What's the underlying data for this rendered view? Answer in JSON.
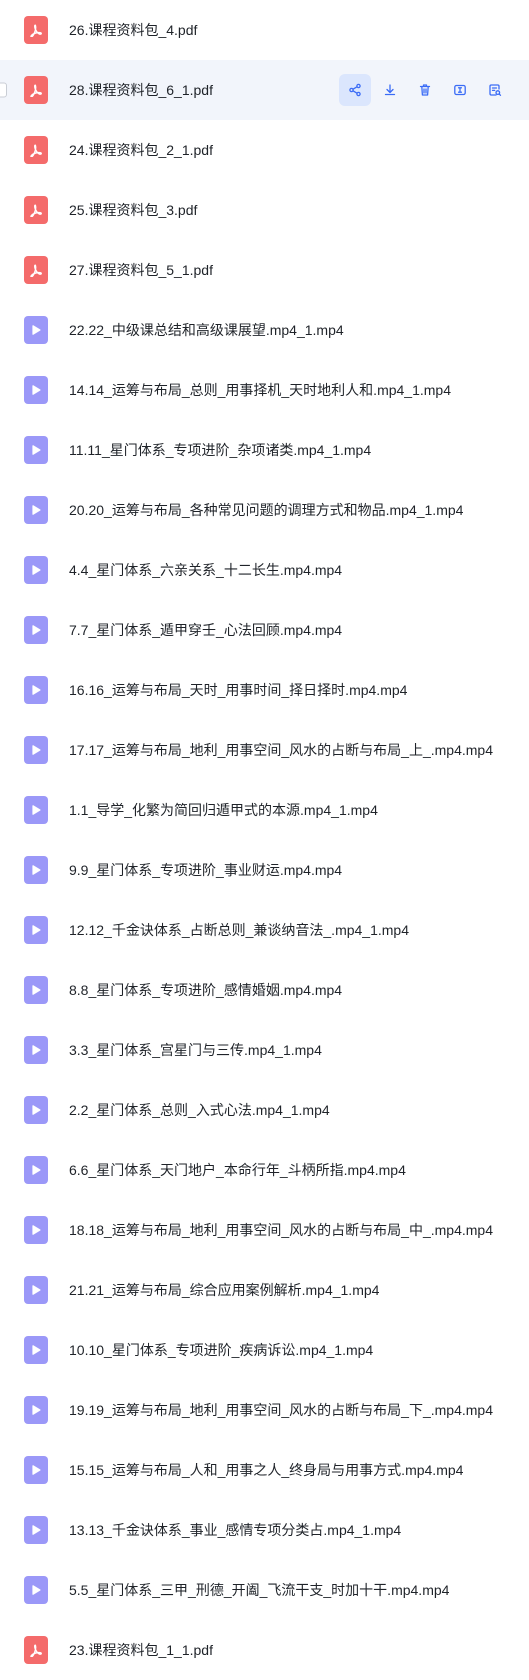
{
  "files": [
    {
      "name": "26.课程资料包_4.pdf",
      "type": "pdf"
    },
    {
      "name": "28.课程资料包_6_1.pdf",
      "type": "pdf",
      "hover": true
    },
    {
      "name": "24.课程资料包_2_1.pdf",
      "type": "pdf"
    },
    {
      "name": "25.课程资料包_3.pdf",
      "type": "pdf"
    },
    {
      "name": "27.课程资料包_5_1.pdf",
      "type": "pdf"
    },
    {
      "name": "22.22_中级课总结和高级课展望.mp4_1.mp4",
      "type": "video"
    },
    {
      "name": "14.14_运筹与布局_总则_用事择机_天时地利人和.mp4_1.mp4",
      "type": "video"
    },
    {
      "name": "11.11_星门体系_专项进阶_杂项诸类.mp4_1.mp4",
      "type": "video"
    },
    {
      "name": "20.20_运筹与布局_各种常见问题的调理方式和物品.mp4_1.mp4",
      "type": "video"
    },
    {
      "name": "4.4_星门体系_六亲关系_十二长生.mp4.mp4",
      "type": "video"
    },
    {
      "name": "7.7_星门体系_遁甲穿壬_心法回顾.mp4.mp4",
      "type": "video"
    },
    {
      "name": "16.16_运筹与布局_天时_用事时间_择日择时.mp4.mp4",
      "type": "video"
    },
    {
      "name": "17.17_运筹与布局_地利_用事空间_风水的占断与布局_上_.mp4.mp4",
      "type": "video"
    },
    {
      "name": "1.1_导学_化繁为简回归遁甲式的本源.mp4_1.mp4",
      "type": "video"
    },
    {
      "name": "9.9_星门体系_专项进阶_事业财运.mp4.mp4",
      "type": "video"
    },
    {
      "name": "12.12_千金诀体系_占断总则_兼谈纳音法_.mp4_1.mp4",
      "type": "video"
    },
    {
      "name": "8.8_星门体系_专项进阶_感情婚姻.mp4.mp4",
      "type": "video"
    },
    {
      "name": "3.3_星门体系_宫星门与三传.mp4_1.mp4",
      "type": "video"
    },
    {
      "name": "2.2_星门体系_总则_入式心法.mp4_1.mp4",
      "type": "video"
    },
    {
      "name": "6.6_星门体系_天门地户_本命行年_斗柄所指.mp4.mp4",
      "type": "video"
    },
    {
      "name": "18.18_运筹与布局_地利_用事空间_风水的占断与布局_中_.mp4.mp4",
      "type": "video"
    },
    {
      "name": "21.21_运筹与布局_综合应用案例解析.mp4_1.mp4",
      "type": "video"
    },
    {
      "name": "10.10_星门体系_专项进阶_疾病诉讼.mp4_1.mp4",
      "type": "video"
    },
    {
      "name": "19.19_运筹与布局_地利_用事空间_风水的占断与布局_下_.mp4.mp4",
      "type": "video"
    },
    {
      "name": "15.15_运筹与布局_人和_用事之人_终身局与用事方式.mp4.mp4",
      "type": "video"
    },
    {
      "name": "13.13_千金诀体系_事业_感情专项分类占.mp4_1.mp4",
      "type": "video"
    },
    {
      "name": "5.5_星门体系_三甲_刑德_开阖_飞流干支_时加十干.mp4.mp4",
      "type": "video"
    },
    {
      "name": "23.课程资料包_1_1.pdf",
      "type": "pdf"
    }
  ],
  "row_actions": [
    {
      "icon": "share-icon",
      "active": true
    },
    {
      "icon": "download-icon"
    },
    {
      "icon": "delete-icon"
    },
    {
      "icon": "rename-icon"
    },
    {
      "icon": "search-text-icon"
    }
  ],
  "colors": {
    "pdf": "#f46b6b",
    "video": "#9b98f8",
    "accent": "#3b6cf6",
    "hover_bg": "#f2f5fb"
  }
}
